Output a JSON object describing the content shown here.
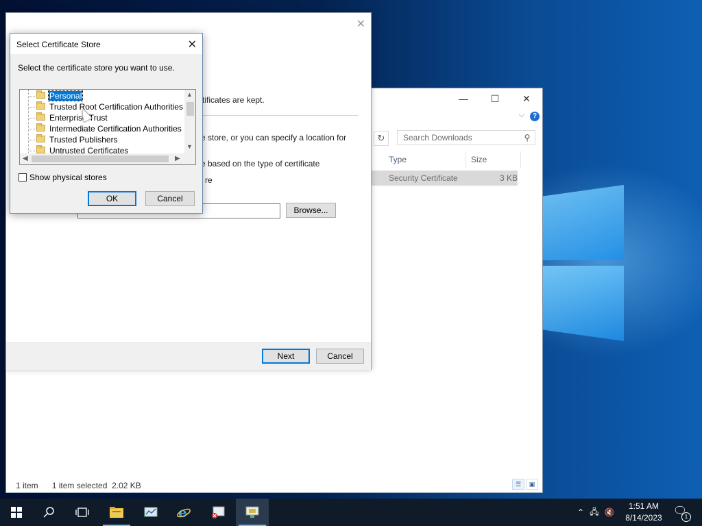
{
  "explorer": {
    "window_controls": {
      "minimize": "—",
      "maximize": "☐",
      "close": "✕"
    },
    "search_placeholder": "Search Downloads",
    "columns": {
      "type": "Type",
      "size": "Size"
    },
    "file": {
      "type": "Security Certificate",
      "size": "3 KB"
    },
    "status": {
      "count": "1 item",
      "selection": "1 item selected  2.02 KB"
    }
  },
  "wizard": {
    "text_kept": "rtificates are kept.",
    "text_store": "e store, or you can specify a location for",
    "text_based": "e based on the type of certificate",
    "text_re": "re",
    "browse_label": "Browse...",
    "next_label": "Next",
    "cancel_label": "Cancel"
  },
  "dialog": {
    "title": "Select Certificate Store",
    "prompt": "Select the certificate store you want to use.",
    "stores": [
      "Personal",
      "Trusted Root Certification Authorities",
      "Enterprise Trust",
      "Intermediate Certification Authorities",
      "Trusted Publishers",
      "Untrusted Certificates"
    ],
    "selected_store": "Personal",
    "show_physical_label": "Show physical stores",
    "show_physical_checked": false,
    "ok_label": "OK",
    "cancel_label": "Cancel"
  },
  "taskbar": {
    "time": "1:51 AM",
    "date": "8/14/2023",
    "notification_count": "1"
  },
  "colors": {
    "accent": "#0078d7",
    "taskbar": "#101b2a"
  }
}
